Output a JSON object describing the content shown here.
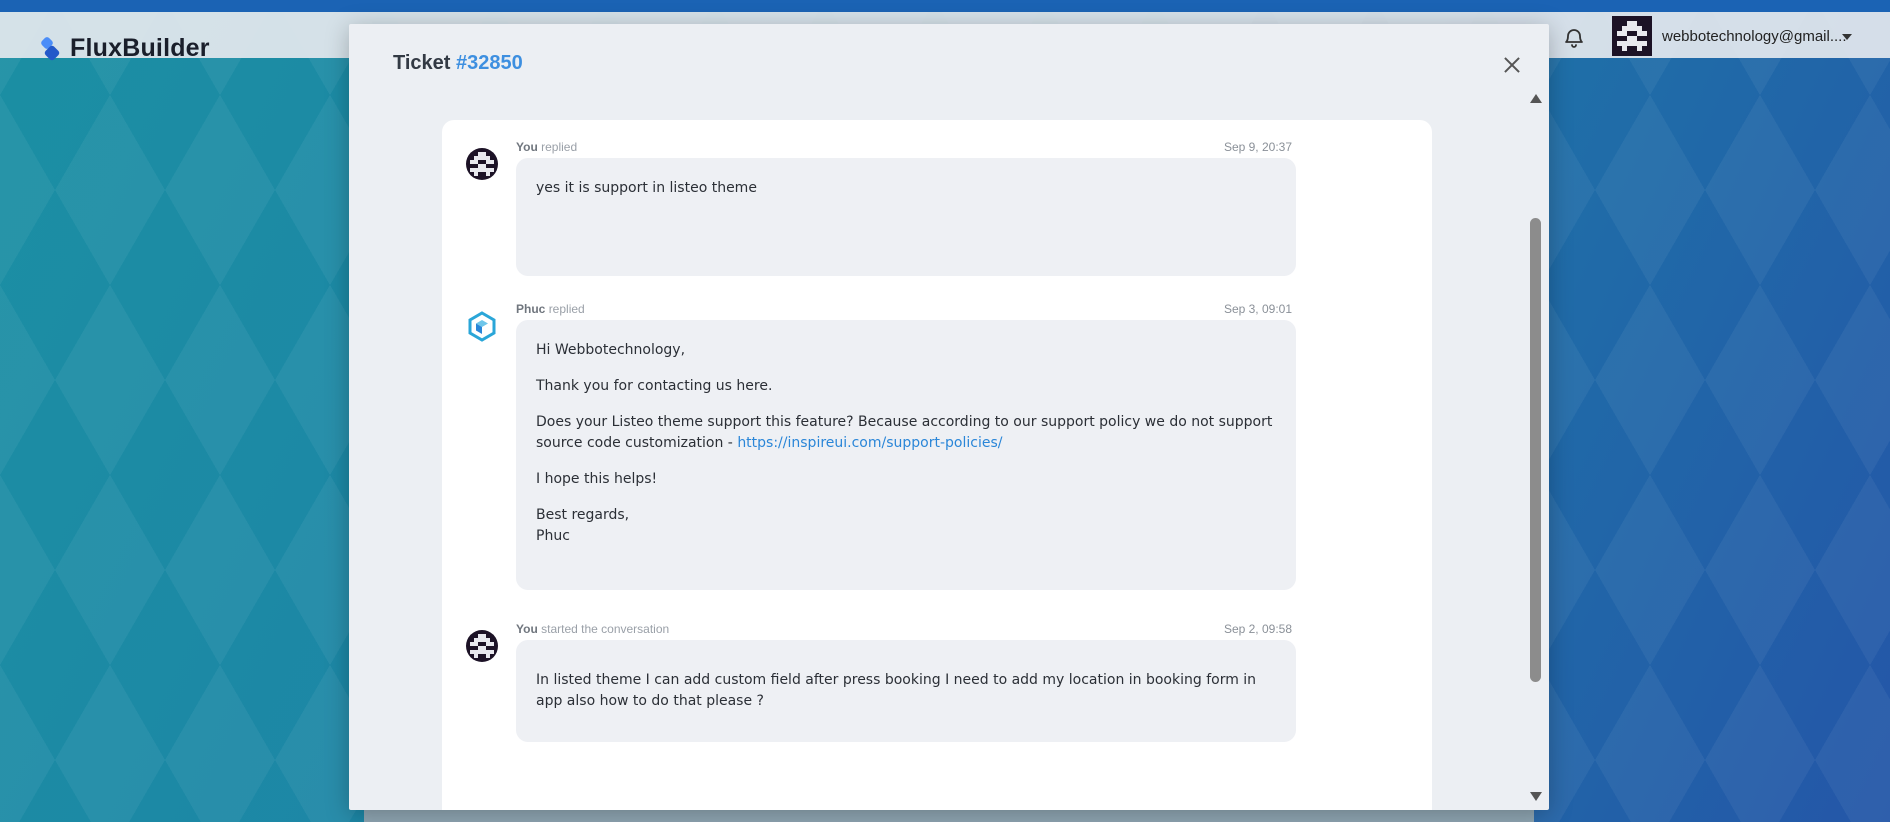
{
  "app": {
    "brand_name": "FluxBuilder",
    "user_email": "webbotechnology@gmail...."
  },
  "colors": {
    "accent": "#3d8fe0",
    "link": "#2a86d8",
    "topstrip": "#1b63b4"
  },
  "icons": [
    "flux-logo-icon",
    "bell-icon",
    "chevron-down-icon",
    "close-icon",
    "scroll-up-icon",
    "scroll-down-icon"
  ],
  "modal": {
    "title_prefix": "Ticket",
    "ticket_id": "#32850"
  },
  "messages": [
    {
      "author": "You",
      "action": "replied",
      "time": "Sep 9, 20:37",
      "paragraphs": [
        "yes it is support in listeo theme"
      ]
    },
    {
      "author": "Phuc",
      "action": "replied",
      "time": "Sep 3, 09:01",
      "greeting": "Hi Webbotechnology,",
      "thanks": "Thank you for contacting us here.",
      "policy_text": "Does your Listeo theme support this feature? Because according to our support policy we do not support source code customization -",
      "policy_link": "https://inspireui.com/support-policies/",
      "helps": "I hope this helps!",
      "regards": "Best regards,",
      "signature": "Phuc"
    },
    {
      "author": "You",
      "action": "started the conversation",
      "time": "Sep 2, 09:58",
      "paragraphs": [
        "In listed theme I can add custom field after press booking I need to add my location in booking form in app also how to do that please ?"
      ]
    }
  ]
}
